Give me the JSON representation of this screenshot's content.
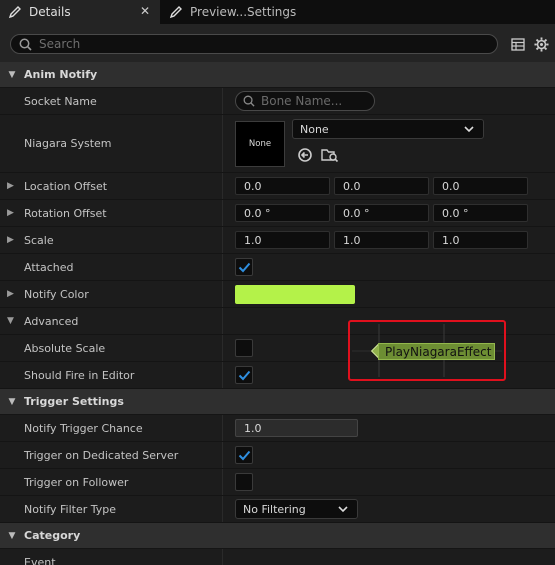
{
  "tabs": [
    {
      "label": "Details",
      "icon": "pencil-icon",
      "active": true
    },
    {
      "label": "Preview...Settings",
      "icon": "pencil-icon",
      "active": false
    }
  ],
  "search": {
    "placeholder": "Search"
  },
  "sections": {
    "anim_notify": "Anim Notify",
    "trigger_settings": "Trigger Settings",
    "category": "Category"
  },
  "props": {
    "socket_name": {
      "label": "Socket Name",
      "placeholder": "Bone Name..."
    },
    "niagara_system": {
      "label": "Niagara System",
      "thumb": "None",
      "value": "None"
    },
    "location_offset": {
      "label": "Location Offset",
      "x": "0.0",
      "y": "0.0",
      "z": "0.0"
    },
    "rotation_offset": {
      "label": "Rotation Offset",
      "x": "0.0 °",
      "y": "0.0 °",
      "z": "0.0 °"
    },
    "scale": {
      "label": "Scale",
      "x": "1.0",
      "y": "1.0",
      "z": "1.0"
    },
    "attached": {
      "label": "Attached",
      "checked": true
    },
    "notify_color": {
      "label": "Notify Color",
      "color": "#b4f249"
    },
    "advanced": {
      "label": "Advanced"
    },
    "absolute_scale": {
      "label": "Absolute Scale",
      "checked": false
    },
    "should_fire": {
      "label": "Should Fire in Editor",
      "checked": true
    },
    "trigger_chance": {
      "label": "Notify Trigger Chance",
      "value": "1.0"
    },
    "dedicated_server": {
      "label": "Trigger on Dedicated Server",
      "checked": true
    },
    "follower": {
      "label": "Trigger on Follower",
      "checked": false
    },
    "filter_type": {
      "label": "Notify Filter Type",
      "value": "No Filtering"
    },
    "event": {
      "label": "Event"
    }
  },
  "notify_marker": {
    "label": "PlayNiagaraEffect"
  },
  "colors": {
    "accent_check": "#2f8fe0",
    "highlight": "#e0101d",
    "notify_fill": "#6d8e33"
  }
}
